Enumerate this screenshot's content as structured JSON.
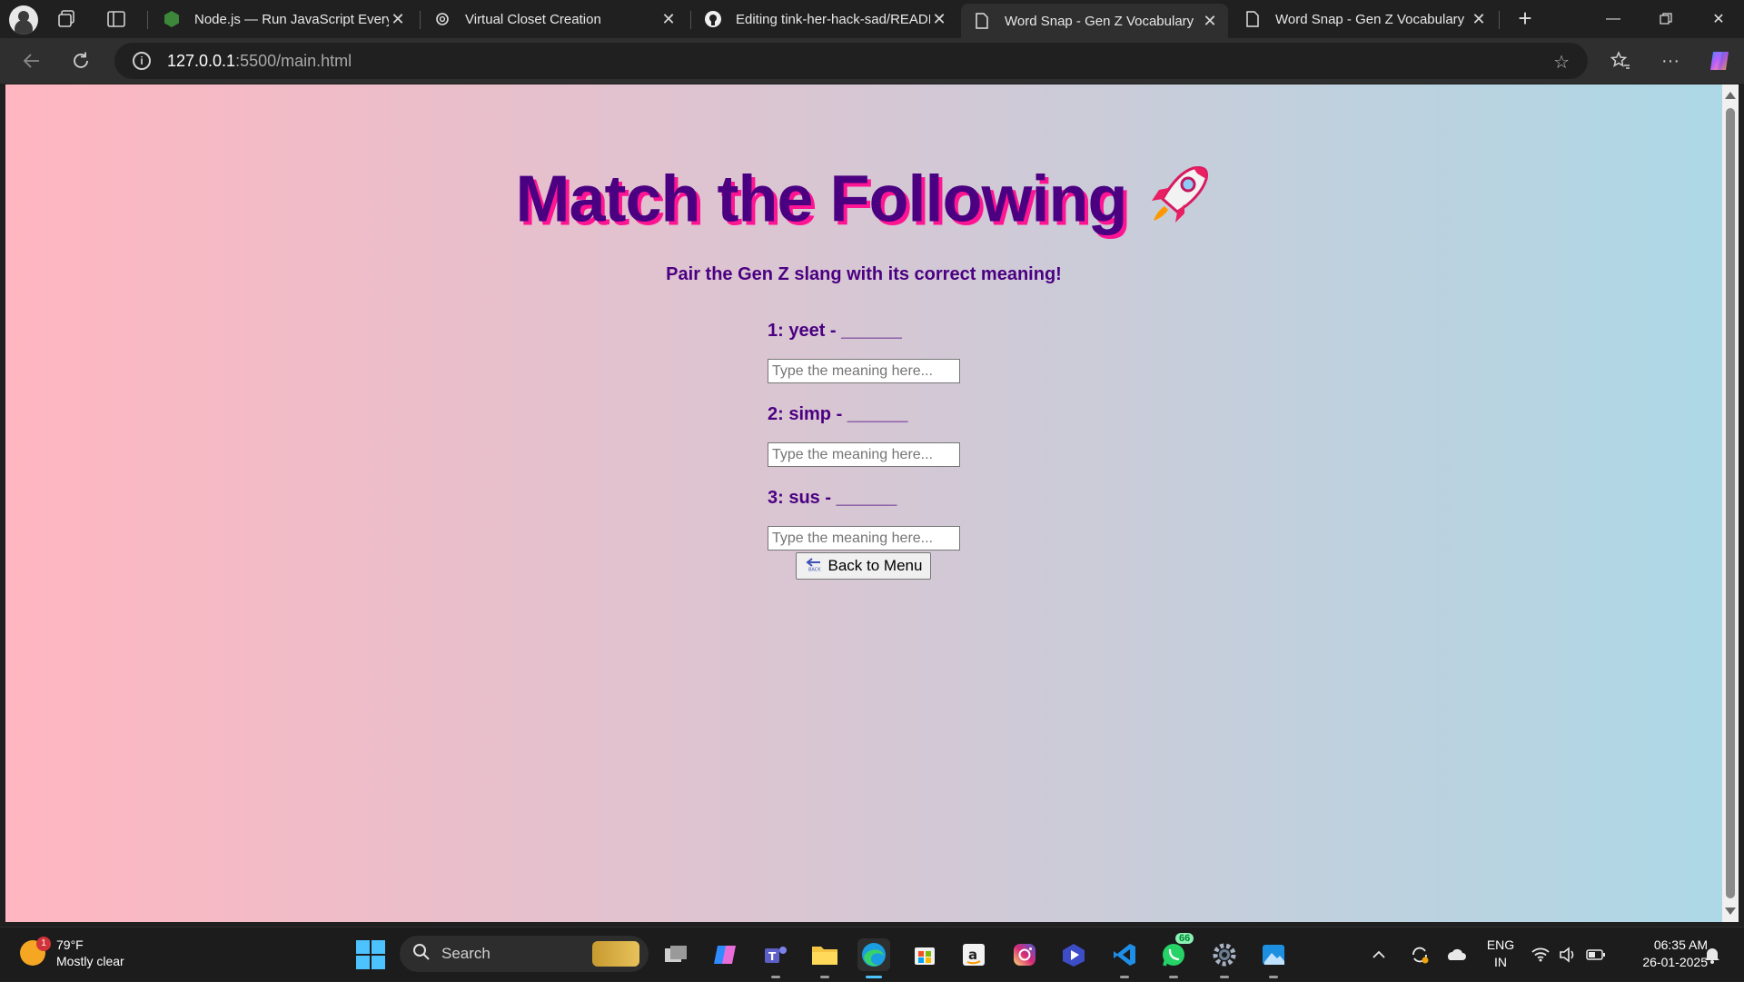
{
  "browser": {
    "tabs": [
      {
        "title": "Node.js — Run JavaScript Everyw",
        "favicon": "node-hex-icon",
        "active": false
      },
      {
        "title": "Virtual Closet Creation",
        "favicon": "openai-icon",
        "active": false
      },
      {
        "title": "Editing tink-her-hack-sad/READM",
        "favicon": "github-icon",
        "active": false
      },
      {
        "title": "Word Snap - Gen Z Vocabulary",
        "favicon": "page-icon",
        "active": true
      },
      {
        "title": "Word Snap - Gen Z Vocabulary",
        "favicon": "page-icon",
        "active": false
      }
    ],
    "url_host": "127.0.0.1",
    "url_rest": ":5500/main.html"
  },
  "page": {
    "title": "Match the Following",
    "title_emoji": "rocket-icon",
    "subtitle": "Pair the Gen Z slang with its correct meaning!",
    "questions": [
      {
        "label": "1: yeet - ______",
        "placeholder": "Type the meaning here...",
        "value": ""
      },
      {
        "label": "2: simp - ______",
        "placeholder": "Type the meaning here...",
        "value": ""
      },
      {
        "label": "3: sus - ______",
        "placeholder": "Type the meaning here...",
        "value": ""
      }
    ],
    "back_button": "Back to Menu",
    "colors": {
      "title": "#4b0082",
      "title_shadow": "#ff1493",
      "gradient_start": "#ffb6c1",
      "gradient_end": "#add8e6"
    }
  },
  "taskbar": {
    "weather_temp": "79°F",
    "weather_desc": "Mostly clear",
    "weather_badge": "1",
    "search_placeholder": "Search",
    "whatsapp_badge": "66",
    "lang_top": "ENG",
    "lang_bottom": "IN",
    "time": "06:35 AM",
    "date": "26-01-2025"
  }
}
